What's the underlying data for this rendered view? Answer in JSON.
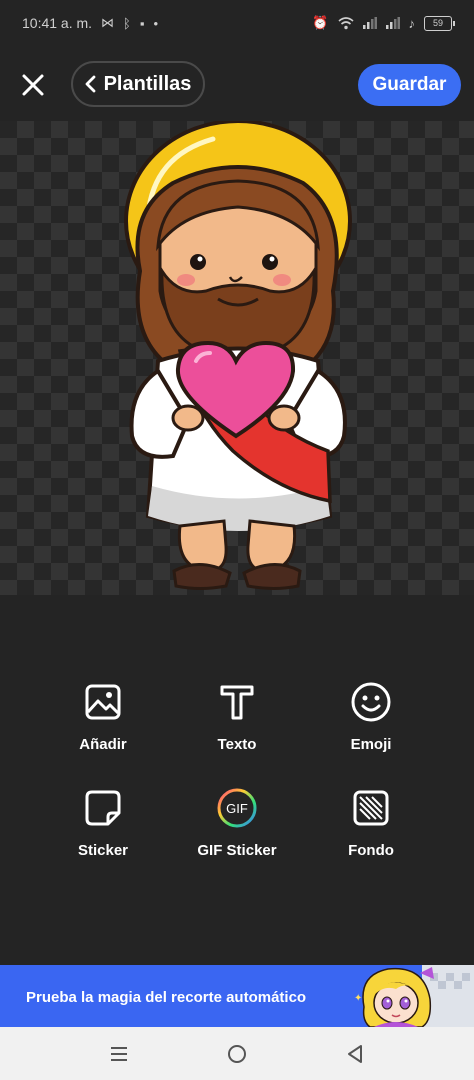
{
  "status_bar": {
    "time": "10:41 a. m.",
    "battery": "59",
    "icons": [
      "bowtie-icon",
      "bluetooth-icon",
      "message-icon",
      "dot-icon",
      "alarm-icon",
      "wifi-icon",
      "signal-icon",
      "signal-icon",
      "mute-icon",
      "battery-icon"
    ]
  },
  "toolbar": {
    "close_icon": "close-icon",
    "templates_label": "Plantillas",
    "templates_icon": "chevron-left-icon",
    "save_label": "Guardar"
  },
  "canvas": {
    "background": "transparency-checkerboard",
    "sticker": "jesus-holding-heart-cartoon"
  },
  "tools": [
    {
      "id": "add",
      "label": "Añadir",
      "icon": "image-icon"
    },
    {
      "id": "text",
      "label": "Texto",
      "icon": "text-icon"
    },
    {
      "id": "emoji",
      "label": "Emoji",
      "icon": "smiley-icon"
    },
    {
      "id": "sticker",
      "label": "Sticker",
      "icon": "sticker-icon"
    },
    {
      "id": "gif-sticker",
      "label": "GIF Sticker",
      "icon": "gif-icon"
    },
    {
      "id": "background",
      "label": "Fondo",
      "icon": "background-pattern-icon"
    }
  ],
  "promo_banner": {
    "text": "Prueba la magia del recorte automático",
    "image": "anime-girl-illustration"
  },
  "nav_bar": {
    "buttons": [
      "menu-icon",
      "home-icon",
      "back-icon"
    ]
  },
  "colors": {
    "accent": "#3b6ef3",
    "background": "#242424",
    "banner": "#3a66f2"
  }
}
